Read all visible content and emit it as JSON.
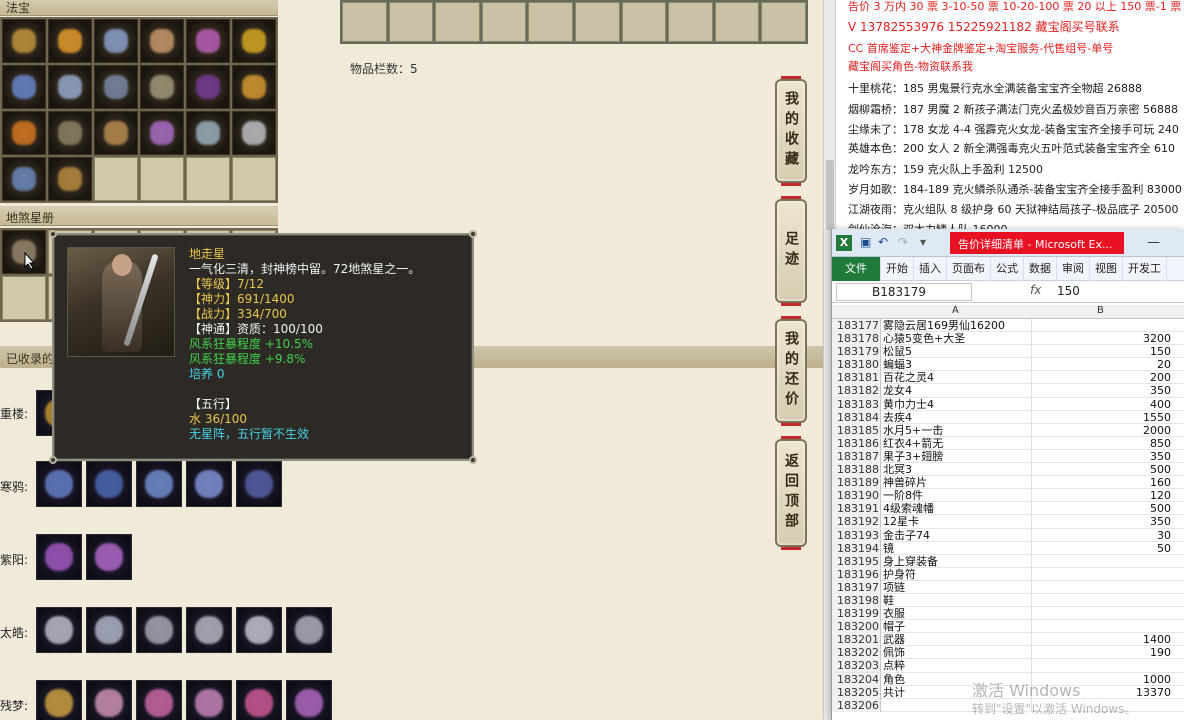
{
  "game": {
    "header_fabao": "法宝",
    "header_disha": "地煞星册",
    "header_collected": "已收录的",
    "slot_count": "物品栏数：5",
    "side_buttons": [
      {
        "label": "我的收藏"
      },
      {
        "label": "足迹"
      },
      {
        "label": "我的还价"
      },
      {
        "label": "返回顶部"
      }
    ],
    "rows": [
      {
        "label": "重楼:"
      },
      {
        "label": "寒鸦:"
      },
      {
        "label": "紫阳:"
      },
      {
        "label": "太皓:"
      },
      {
        "label": "残梦:"
      }
    ],
    "tooltip": {
      "name": "地走星",
      "desc": "一气化三清，封神榜中留。72地煞星之一。",
      "level_label": "【等级】",
      "level": "7/12",
      "divine_label": "【神力】",
      "divine": "691/1400",
      "combat_label": "【战力】",
      "combat": "334/700",
      "shentong_label": "【神通】",
      "shentong": "资质：100/100",
      "wind1": "风系狂暴程度 +10.5%",
      "wind2": "风系狂暴程度 +9.8%",
      "cultivate": "培养 0",
      "wuxing_label": "【五行】",
      "water": "水 36/100",
      "note": "无星阵，五行暂不生效"
    }
  },
  "doc": {
    "lines": [
      {
        "text": "告价 3 万内 30 票  3-10-50 票  10-20-100 票  20 以上 150 票-1 票 1 元",
        "color": "red"
      },
      {
        "text": "V 13782553976    15225921182  藏宝阁买号联系",
        "color": "red"
      },
      {
        "text": "CC 首席鉴定+大神金牌鉴定+淘宝服务-代售组号-单号",
        "color": "red"
      },
      {
        "text": "藏宝阁买角色-物资联系我",
        "color": "red"
      },
      {
        "text": "十里桃花：185 男鬼景行克水全满装备宝宝齐全物超 26888",
        "color": "blk"
      },
      {
        "text": "烟柳霜桥：187 男魔 2 新孩子满法门克火孟极妙音百万亲密 56888",
        "color": "blk"
      },
      {
        "text": "尘缘未了：178 女龙 4-4 强霹克火女龙-装备宝宝齐全接手可玩 240",
        "color": "blk"
      },
      {
        "text": "英雄本色：200 女人 2 新全满强毒克火五叶范式装备宝宝齐全 610",
        "color": "blk"
      },
      {
        "text": "龙吟东方：159 克火队上手盈利 12500",
        "color": "blk"
      },
      {
        "text": "岁月如歌：184-189 克火鳞杀队通杀-装备宝宝齐全接手盈利 83000",
        "color": "blk"
      },
      {
        "text": "江湖夜雨：克火组队 8 级护身 60 天狱神结局孩子-极品底子 20500",
        "color": "blk"
      },
      {
        "text": "剑仙沧海：双太力鳞人队 16000",
        "color": "blk"
      }
    ]
  },
  "excel": {
    "logo": "X",
    "title": "告价详细清单 - Microsoft Ex...",
    "tabs": [
      "文件",
      "开始",
      "插入",
      "页面布",
      "公式",
      "数据",
      "审阅",
      "视图",
      "开发工"
    ],
    "namebox": "B183179",
    "fx": "fx",
    "formula_value": "150",
    "col_a": "A",
    "col_b": "B",
    "rows": [
      {
        "n": "183177",
        "a": "雾隐云居169男仙16200",
        "b": ""
      },
      {
        "n": "183178",
        "a": "心猿5变色+大圣",
        "b": "3200"
      },
      {
        "n": "183179",
        "a": "松鼠5",
        "b": "150"
      },
      {
        "n": "183180",
        "a": "蝙蝠3",
        "b": "20"
      },
      {
        "n": "183181",
        "a": "百花之灵4",
        "b": "200"
      },
      {
        "n": "183182",
        "a": "龙女4",
        "b": "350"
      },
      {
        "n": "183183",
        "a": "黄巾力士4",
        "b": "400"
      },
      {
        "n": "183184",
        "a": "去疾4",
        "b": "1550"
      },
      {
        "n": "183185",
        "a": "水月5+一击",
        "b": "2000"
      },
      {
        "n": "183186",
        "a": "红衣4+箭无",
        "b": "850"
      },
      {
        "n": "183187",
        "a": "果子3+翅膀",
        "b": "350"
      },
      {
        "n": "183188",
        "a": "北冥3",
        "b": "500"
      },
      {
        "n": "183189",
        "a": "神兽碎片",
        "b": "160"
      },
      {
        "n": "183190",
        "a": "一阶8件",
        "b": "120"
      },
      {
        "n": "183191",
        "a": "4级索魂幡",
        "b": "500"
      },
      {
        "n": "183192",
        "a": "12星卡",
        "b": "350"
      },
      {
        "n": "183193",
        "a": "金击子74",
        "b": "30"
      },
      {
        "n": "183194",
        "a": "镜",
        "b": "50"
      },
      {
        "n": "183195",
        "a": "身上穿装备",
        "b": ""
      },
      {
        "n": "183196",
        "a": "护身符",
        "b": ""
      },
      {
        "n": "183197",
        "a": "项链",
        "b": ""
      },
      {
        "n": "183198",
        "a": "鞋",
        "b": ""
      },
      {
        "n": "183199",
        "a": "衣服",
        "b": ""
      },
      {
        "n": "183200",
        "a": "帽子",
        "b": ""
      },
      {
        "n": "183201",
        "a": "武器",
        "b": "1400"
      },
      {
        "n": "183202",
        "a": "佩饰",
        "b": "190"
      },
      {
        "n": "183203",
        "a": "点粹",
        "b": ""
      },
      {
        "n": "183204",
        "a": "角色",
        "b": "1000"
      },
      {
        "n": "183205",
        "a": "共计",
        "b": "13370"
      },
      {
        "n": "183206",
        "a": "",
        "b": ""
      }
    ]
  },
  "watermark": {
    "line1": "激活 Windows",
    "line2": "转到\"设置\"以激活 Windows。"
  }
}
